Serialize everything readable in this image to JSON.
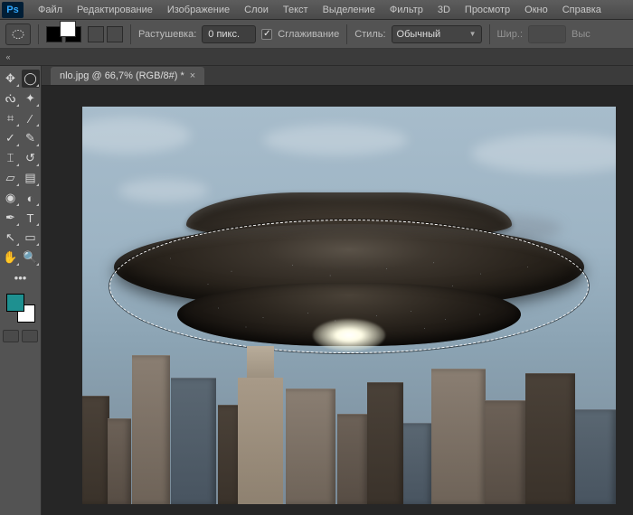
{
  "menu": {
    "items": [
      "Файл",
      "Редактирование",
      "Изображение",
      "Слои",
      "Текст",
      "Выделение",
      "Фильтр",
      "3D",
      "Просмотр",
      "Окно",
      "Справка"
    ]
  },
  "options": {
    "feather_label": "Растушевка:",
    "feather_value": "0 пикс.",
    "antialias_label": "Сглаживание",
    "antialias_checked": true,
    "style_label": "Стиль:",
    "style_value": "Обычный",
    "width_label": "Шир.:",
    "height_label": "Выс"
  },
  "document": {
    "tab_title": "nlo.jpg @ 66,7% (RGB/8#) *"
  },
  "colors": {
    "foreground": "#1e9090",
    "background": "#ffffff"
  },
  "tools": [
    [
      "move",
      "marquee-ellipse"
    ],
    [
      "lasso",
      "magic-wand"
    ],
    [
      "crop",
      "eyedropper"
    ],
    [
      "spot-heal",
      "brush"
    ],
    [
      "clone-stamp",
      "history-brush"
    ],
    [
      "eraser",
      "gradient"
    ],
    [
      "blur",
      "dodge"
    ],
    [
      "pen",
      "type"
    ],
    [
      "path-select",
      "rectangle"
    ],
    [
      "hand",
      "zoom"
    ]
  ],
  "tool_glyphs": {
    "move": "✥",
    "marquee-ellipse": "◯",
    "lasso": "ᔔ",
    "magic-wand": "✦",
    "crop": "⌗",
    "eyedropper": "⁄",
    "spot-heal": "✓",
    "brush": "✎",
    "clone-stamp": "⌶",
    "history-brush": "↺",
    "eraser": "▱",
    "gradient": "▤",
    "blur": "◉",
    "dodge": "◐",
    "pen": "✒",
    "type": "T",
    "path-select": "↖",
    "rectangle": "▭",
    "hand": "✋",
    "zoom": "🔍"
  },
  "selected_tool": "marquee-ellipse"
}
